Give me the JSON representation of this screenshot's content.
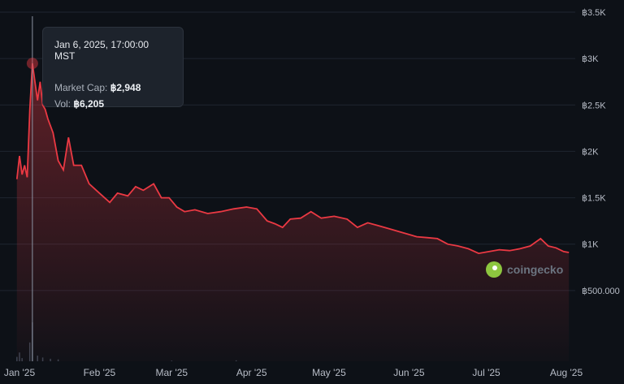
{
  "chart_data": {
    "type": "area",
    "x_ticks": [
      "Jan '25",
      "Feb '25",
      "Mar '25",
      "Apr '25",
      "May '25",
      "Jun '25",
      "Jul '25",
      "Aug '25"
    ],
    "y_ticks": [
      "฿500.000",
      "฿1K",
      "฿1.5K",
      "฿2K",
      "฿2.5K",
      "฿3K",
      "฿3.5K"
    ],
    "ylim": [
      0,
      3500
    ],
    "grid": true,
    "colors": {
      "line": "#ea3943",
      "background": "#0d1117",
      "grid": "#1f2530",
      "crosshair": "#8a93a2",
      "volume": "#3b4350"
    },
    "series": [
      {
        "values": [
          {
            "x": "2024-12-31",
            "y": 1700
          },
          {
            "x": "2025-01-01",
            "y": 1950
          },
          {
            "x": "2025-01-02",
            "y": 1750
          },
          {
            "x": "2025-01-03",
            "y": 1850
          },
          {
            "x": "2025-01-04",
            "y": 1720
          },
          {
            "x": "2025-01-05",
            "y": 2450
          },
          {
            "x": "2025-01-06",
            "y": 2948
          },
          {
            "x": "2025-01-07",
            "y": 2750
          },
          {
            "x": "2025-01-08",
            "y": 2550
          },
          {
            "x": "2025-01-09",
            "y": 2750
          },
          {
            "x": "2025-01-10",
            "y": 2500
          },
          {
            "x": "2025-01-11",
            "y": 2450
          },
          {
            "x": "2025-01-12",
            "y": 2350
          },
          {
            "x": "2025-01-14",
            "y": 2200
          },
          {
            "x": "2025-01-16",
            "y": 1900
          },
          {
            "x": "2025-01-18",
            "y": 1800
          },
          {
            "x": "2025-01-20",
            "y": 2150
          },
          {
            "x": "2025-01-22",
            "y": 1850
          },
          {
            "x": "2025-01-25",
            "y": 1850
          },
          {
            "x": "2025-01-28",
            "y": 1650
          },
          {
            "x": "2025-02-01",
            "y": 1550
          },
          {
            "x": "2025-02-05",
            "y": 1450
          },
          {
            "x": "2025-02-08",
            "y": 1550
          },
          {
            "x": "2025-02-12",
            "y": 1520
          },
          {
            "x": "2025-02-15",
            "y": 1620
          },
          {
            "x": "2025-02-18",
            "y": 1580
          },
          {
            "x": "2025-02-22",
            "y": 1650
          },
          {
            "x": "2025-02-25",
            "y": 1500
          },
          {
            "x": "2025-02-28",
            "y": 1500
          },
          {
            "x": "2025-03-03",
            "y": 1400
          },
          {
            "x": "2025-03-06",
            "y": 1350
          },
          {
            "x": "2025-03-10",
            "y": 1370
          },
          {
            "x": "2025-03-15",
            "y": 1330
          },
          {
            "x": "2025-03-20",
            "y": 1350
          },
          {
            "x": "2025-03-25",
            "y": 1380
          },
          {
            "x": "2025-03-30",
            "y": 1400
          },
          {
            "x": "2025-04-03",
            "y": 1380
          },
          {
            "x": "2025-04-07",
            "y": 1250
          },
          {
            "x": "2025-04-10",
            "y": 1220
          },
          {
            "x": "2025-04-13",
            "y": 1180
          },
          {
            "x": "2025-04-16",
            "y": 1270
          },
          {
            "x": "2025-04-20",
            "y": 1280
          },
          {
            "x": "2025-04-24",
            "y": 1350
          },
          {
            "x": "2025-04-28",
            "y": 1280
          },
          {
            "x": "2025-05-03",
            "y": 1300
          },
          {
            "x": "2025-05-08",
            "y": 1270
          },
          {
            "x": "2025-05-12",
            "y": 1180
          },
          {
            "x": "2025-05-16",
            "y": 1230
          },
          {
            "x": "2025-05-20",
            "y": 1200
          },
          {
            "x": "2025-05-25",
            "y": 1160
          },
          {
            "x": "2025-05-30",
            "y": 1120
          },
          {
            "x": "2025-06-04",
            "y": 1080
          },
          {
            "x": "2025-06-08",
            "y": 1070
          },
          {
            "x": "2025-06-12",
            "y": 1060
          },
          {
            "x": "2025-06-16",
            "y": 1000
          },
          {
            "x": "2025-06-20",
            "y": 980
          },
          {
            "x": "2025-06-24",
            "y": 950
          },
          {
            "x": "2025-06-28",
            "y": 900
          },
          {
            "x": "2025-07-02",
            "y": 920
          },
          {
            "x": "2025-07-06",
            "y": 940
          },
          {
            "x": "2025-07-10",
            "y": 930
          },
          {
            "x": "2025-07-14",
            "y": 950
          },
          {
            "x": "2025-07-18",
            "y": 980
          },
          {
            "x": "2025-07-22",
            "y": 1060
          },
          {
            "x": "2025-07-25",
            "y": 980
          },
          {
            "x": "2025-07-28",
            "y": 960
          },
          {
            "x": "2025-07-31",
            "y": 920
          },
          {
            "x": "2025-08-02",
            "y": 910
          }
        ]
      }
    ],
    "volume": [
      {
        "x": "2024-12-31",
        "y": 700
      },
      {
        "x": "2025-01-01",
        "y": 1400
      },
      {
        "x": "2025-01-02",
        "y": 500
      },
      {
        "x": "2025-01-05",
        "y": 3000
      },
      {
        "x": "2025-01-06",
        "y": 6205
      },
      {
        "x": "2025-01-08",
        "y": 900
      },
      {
        "x": "2025-01-10",
        "y": 600
      },
      {
        "x": "2025-01-13",
        "y": 400
      },
      {
        "x": "2025-01-16",
        "y": 300
      },
      {
        "x": "2025-03-01",
        "y": 100
      },
      {
        "x": "2025-03-26",
        "y": 150
      }
    ],
    "tooltip": {
      "date": "Jan 6, 2025, 17:00:00 MST",
      "market_cap_label": "Market Cap:",
      "market_cap_value": "฿2,948",
      "vol_label": "Vol:",
      "vol_value": "฿6,205"
    },
    "watermark": "coingecko"
  }
}
